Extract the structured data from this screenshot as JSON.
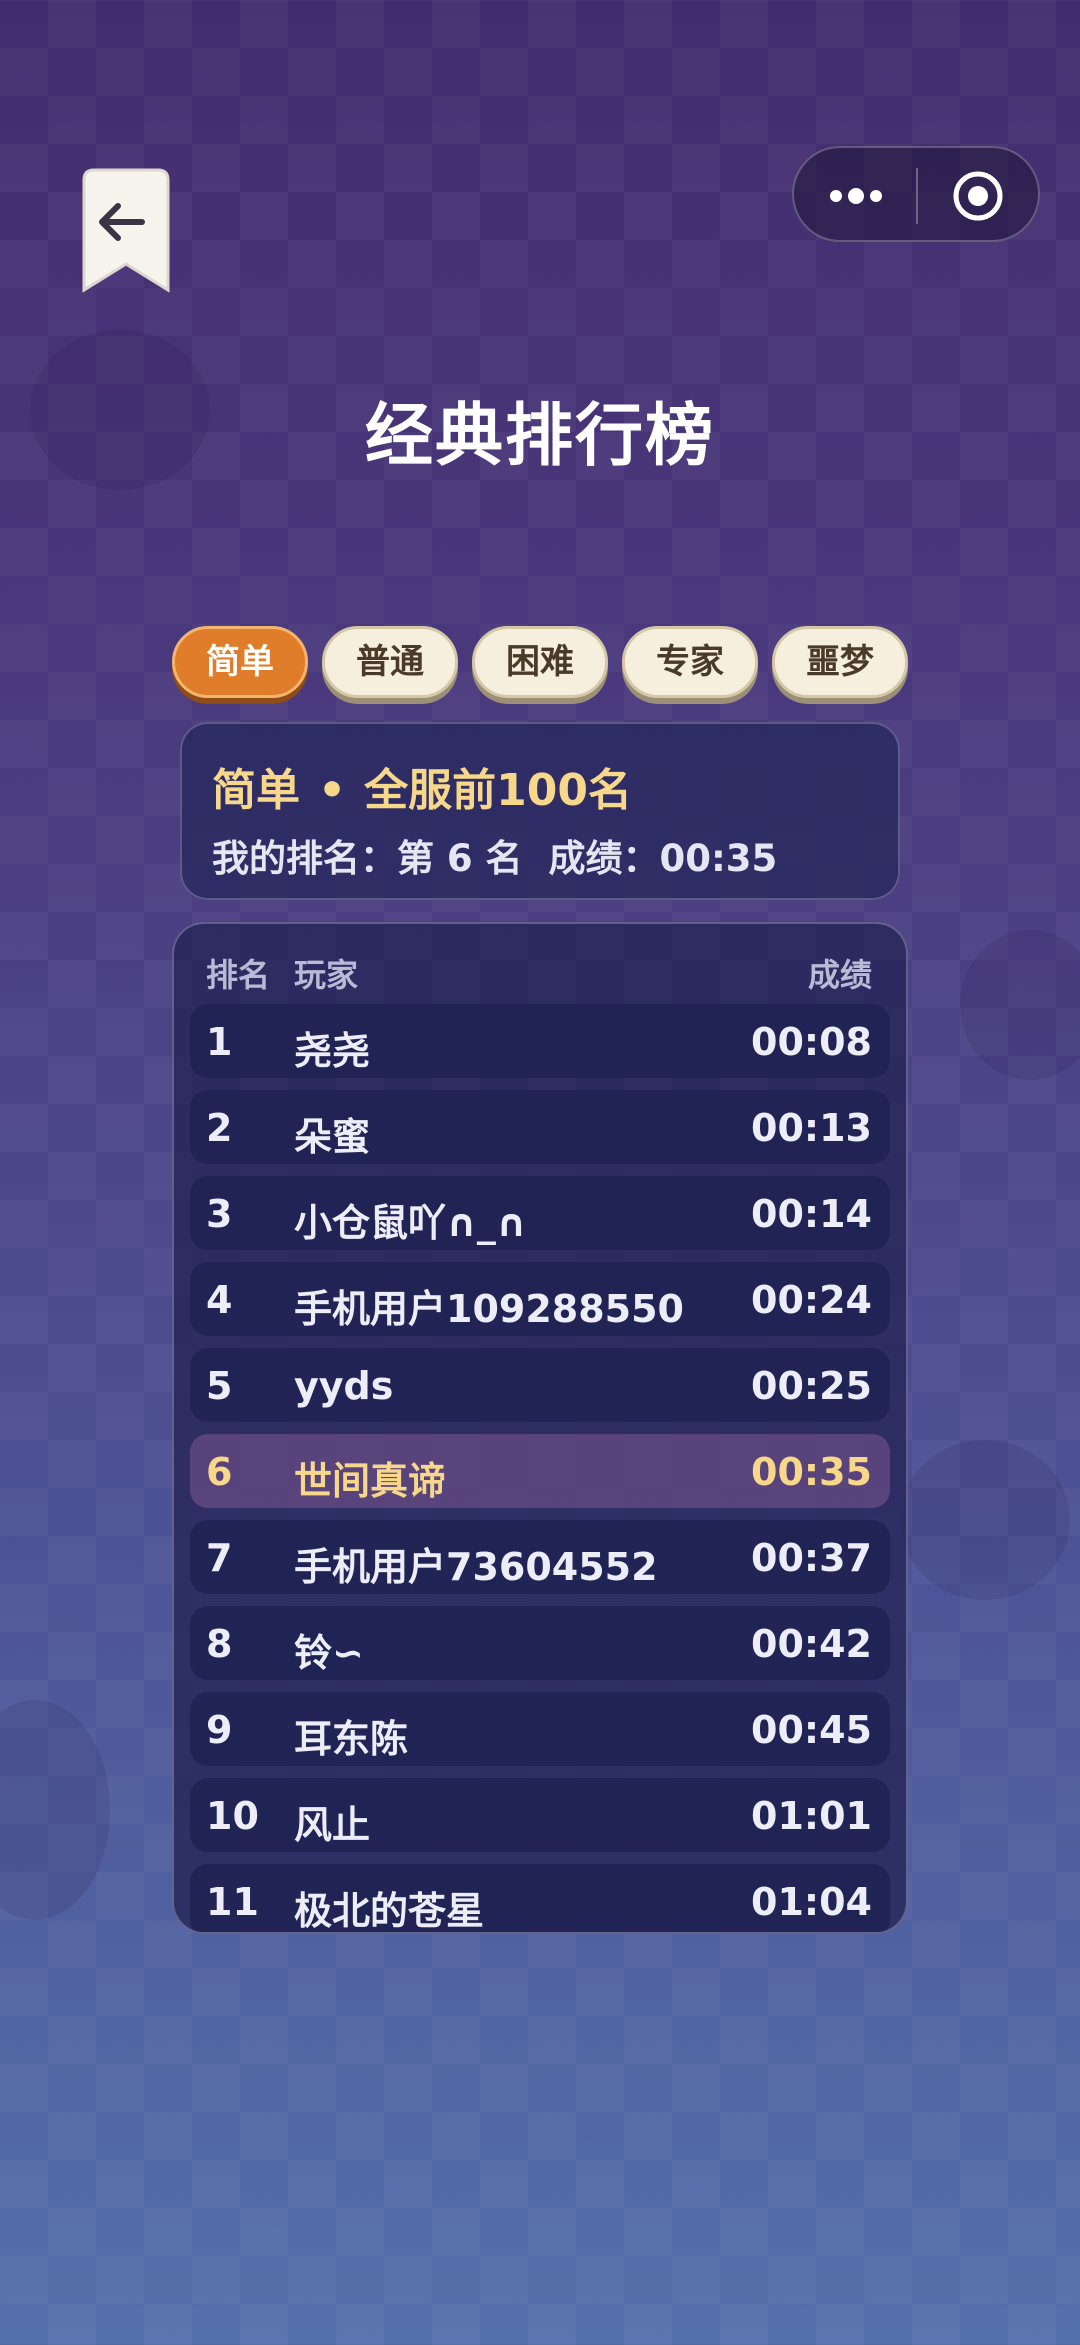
{
  "nav": {
    "back_icon": "back-arrow-icon",
    "capsule_more_icon": "more-dots-icon",
    "capsule_close_icon": "target-circle-icon"
  },
  "page_title": "经典排行榜",
  "tabs": [
    {
      "label": "简单",
      "active": true
    },
    {
      "label": "普通",
      "active": false
    },
    {
      "label": "困难",
      "active": false
    },
    {
      "label": "专家",
      "active": false
    },
    {
      "label": "噩梦",
      "active": false
    }
  ],
  "summary": {
    "difficulty": "简单",
    "separator": "•",
    "scope": "全服前100名",
    "my_rank_label": "我的排名：",
    "my_rank_value": "第 6 名",
    "score_label": "成绩：",
    "score_value": "00:35"
  },
  "board": {
    "columns": {
      "rank": "排名",
      "player": "玩家",
      "score": "成绩"
    },
    "rows": [
      {
        "rank": "1",
        "name": "尧尧",
        "score": "00:08"
      },
      {
        "rank": "2",
        "name": "朵蜜",
        "score": "00:13"
      },
      {
        "rank": "3",
        "name": "小仓鼠吖∩_∩",
        "score": "00:14"
      },
      {
        "rank": "4",
        "name": "手机用户109288550",
        "score": "00:24"
      },
      {
        "rank": "5",
        "name": "yyds",
        "score": "00:25"
      },
      {
        "rank": "6",
        "name": "世间真谛",
        "score": "00:35",
        "is_me": true
      },
      {
        "rank": "7",
        "name": "手机用户73604552",
        "score": "00:37"
      },
      {
        "rank": "8",
        "name": "铃∽",
        "score": "00:42"
      },
      {
        "rank": "9",
        "name": "耳东陈",
        "score": "00:45"
      },
      {
        "rank": "10",
        "name": "风止",
        "score": "01:01"
      },
      {
        "rank": "11",
        "name": "极北的苍星",
        "score": "01:04"
      }
    ]
  },
  "colors": {
    "accent_tab": "#df7d2a",
    "highlight_text": "#f7d88a"
  }
}
